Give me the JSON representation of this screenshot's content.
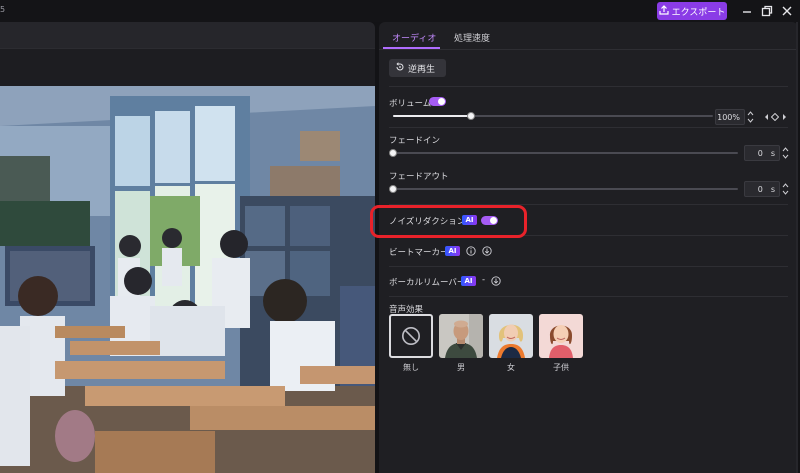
{
  "topbar": {
    "edge_text": "5",
    "export_label": "エクスポート",
    "export_icon": "upload-icon",
    "colors": {
      "export_bg": "#8a3ce6"
    }
  },
  "panel": {
    "tabs": [
      {
        "label": "オーディオ",
        "active": true
      },
      {
        "label": "処理速度",
        "active": false
      }
    ],
    "reverse_label": "逆再生",
    "volume": {
      "label": "ボリューム",
      "enabled": true,
      "value_percent": 100,
      "display": "100%"
    },
    "fade_in": {
      "label": "フェードイン",
      "value": "0",
      "unit": "s"
    },
    "fade_out": {
      "label": "フェードアウト",
      "value": "0",
      "unit": "s"
    },
    "noise_reduction": {
      "label": "ノイズリダクション",
      "ai_badge": "AI",
      "enabled": true
    },
    "beat_marker": {
      "label": "ビートマーカー",
      "ai_badge": "AI"
    },
    "vocal_remover": {
      "label": "ボーカルリムーバー",
      "ai_badge": "AI",
      "separator": "-"
    },
    "voice_effects": {
      "heading": "音声効果",
      "options": [
        {
          "label": "無し",
          "icon": "none-icon",
          "selected": true
        },
        {
          "label": "男",
          "icon": "male-avatar"
        },
        {
          "label": "女",
          "icon": "female-avatar"
        },
        {
          "label": "子供",
          "icon": "child-avatar"
        }
      ]
    },
    "accent_color": "#b06dff",
    "highlight_color": "#e8222a"
  }
}
